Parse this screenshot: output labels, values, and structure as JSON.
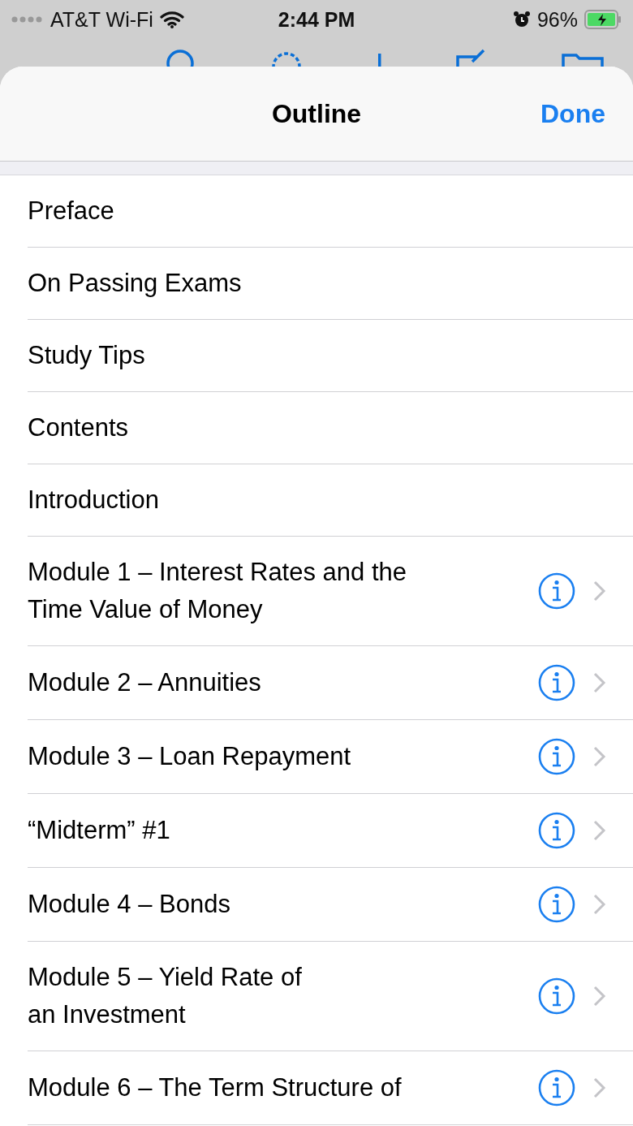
{
  "status_bar": {
    "carrier": "AT&T Wi-Fi",
    "time": "2:44 PM",
    "battery": "96%"
  },
  "sheet": {
    "title": "Outline",
    "done": "Done"
  },
  "items": [
    {
      "title": "Preface",
      "kind": "plain"
    },
    {
      "title": "On Passing Exams",
      "kind": "plain"
    },
    {
      "title": "Study Tips",
      "kind": "plain"
    },
    {
      "title": "Contents",
      "kind": "plain"
    },
    {
      "title": "Introduction",
      "kind": "plain"
    },
    {
      "title": "Module 1 – Interest Rates and the\nTime Value of Money",
      "kind": "detail"
    },
    {
      "title": "Module 2 – Annuities",
      "kind": "detail"
    },
    {
      "title": "Module 3 – Loan Repayment",
      "kind": "detail"
    },
    {
      "title": "“Midterm” #1",
      "kind": "detail"
    },
    {
      "title": "Module 4 – Bonds",
      "kind": "detail"
    },
    {
      "title": "Module 5 – Yield Rate of\nan Investment",
      "kind": "detail"
    },
    {
      "title": "Module 6 – The Term Structure of",
      "kind": "detail"
    }
  ]
}
